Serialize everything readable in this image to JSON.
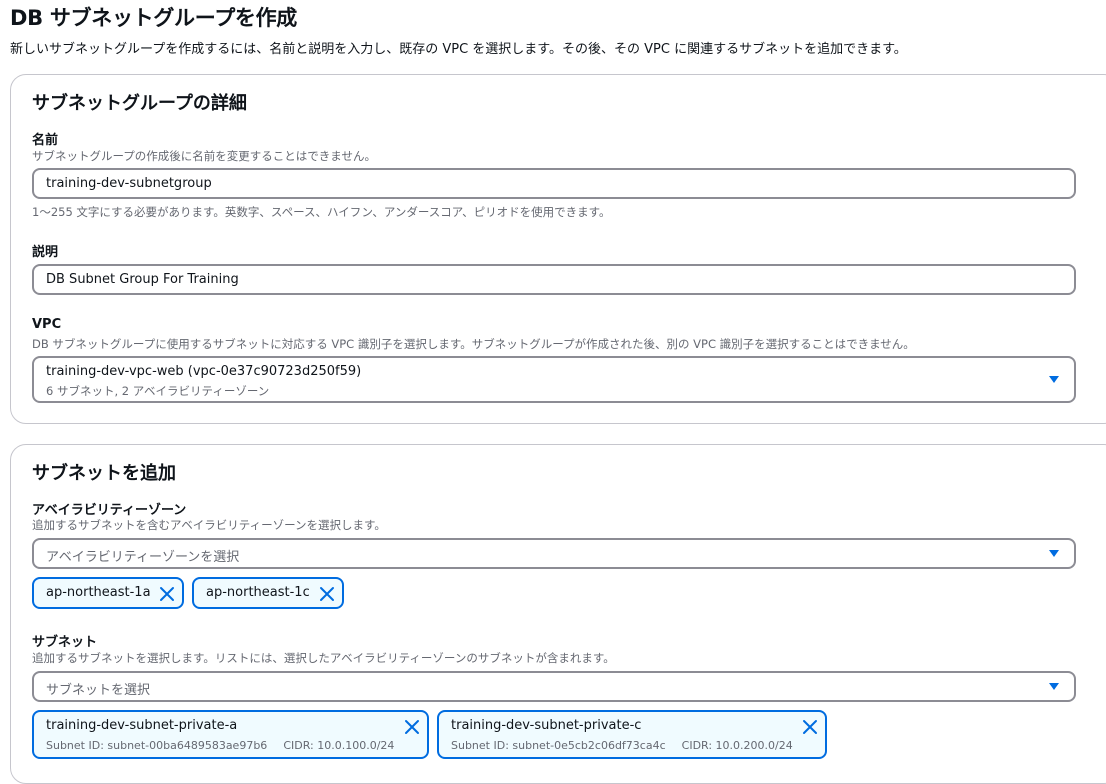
{
  "page": {
    "title": "DB サブネットグループを作成",
    "description": "新しいサブネットグループを作成するには、名前と説明を入力し、既存の VPC を選択します。その後、その VPC に関連するサブネットを追加できます。"
  },
  "details": {
    "title": "サブネットグループの詳細",
    "name": {
      "label": "名前",
      "help": "サブネットグループの作成後に名前を変更することはできません。",
      "value": "training-dev-subnetgroup",
      "constraint": "1～255 文字にする必要があります。英数字、スペース、ハイフン、アンダースコア、ピリオドを使用できます。"
    },
    "description": {
      "label": "説明",
      "value": "DB Subnet Group For Training"
    },
    "vpc": {
      "label": "VPC",
      "help": "DB サブネットグループに使用するサブネットに対応する VPC 識別子を選択します。サブネットグループが作成された後、別の VPC 識別子を選択することはできません。",
      "selected": "training-dev-vpc-web (vpc-0e37c90723d250f59)",
      "selected_detail": "6 サブネット, 2 アベイラビリティーゾーン"
    }
  },
  "subnets_section": {
    "title": "サブネットを追加",
    "az": {
      "label": "アベイラビリティーゾーン",
      "help": "追加するサブネットを含むアベイラビリティーゾーンを選択します。",
      "placeholder": "アベイラビリティーゾーンを選択",
      "tokens": [
        {
          "label": "ap-northeast-1a"
        },
        {
          "label": "ap-northeast-1c"
        }
      ]
    },
    "subnet": {
      "label": "サブネット",
      "help": "追加するサブネットを選択します。リストには、選択したアベイラビリティーゾーンのサブネットが含まれます。",
      "placeholder": "サブネットを選択",
      "tokens": [
        {
          "label": "training-dev-subnet-private-a",
          "subnet_id": "Subnet ID: subnet-00ba6489583ae97b6",
          "cidr": "CIDR: 10.0.100.0/24"
        },
        {
          "label": "training-dev-subnet-private-c",
          "subnet_id": "Subnet ID: subnet-0e5cb2c06df73ca4c",
          "cidr": "CIDR: 10.0.200.0/24"
        }
      ]
    }
  },
  "colors": {
    "accent": "#006ce0",
    "token_bg": "#f0fbff",
    "border": "#8c8c94",
    "muted_text": "#656871"
  },
  "icons": {
    "dropdown": "caret-down-icon",
    "dismiss": "close-icon"
  }
}
